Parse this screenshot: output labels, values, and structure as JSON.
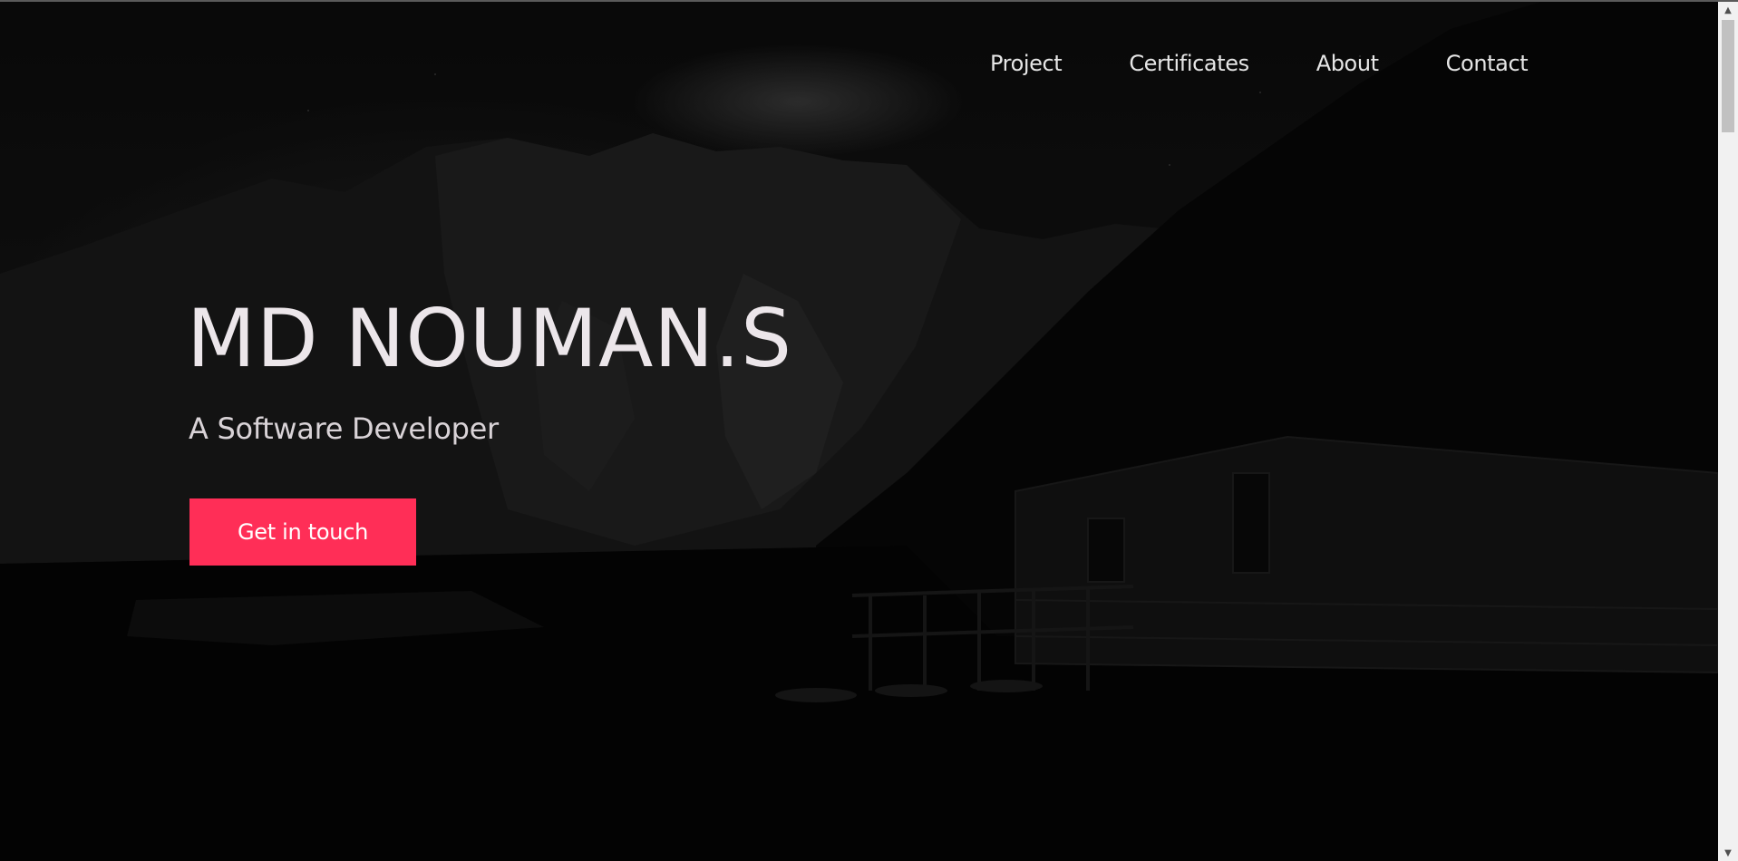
{
  "header": {
    "nav": [
      {
        "label": "Project"
      },
      {
        "label": "Certificates"
      },
      {
        "label": "About"
      },
      {
        "label": "Contact"
      }
    ]
  },
  "hero": {
    "title": "MD NOUMAN.S",
    "subtitle": "A Software Developer",
    "cta_label": "Get in touch"
  },
  "colors": {
    "accent": "#ff2e57",
    "text": "#ece6ea",
    "background": "#000000"
  },
  "icons": {
    "scroll_up": "triangle-up-icon",
    "scroll_down": "triangle-down-icon"
  }
}
